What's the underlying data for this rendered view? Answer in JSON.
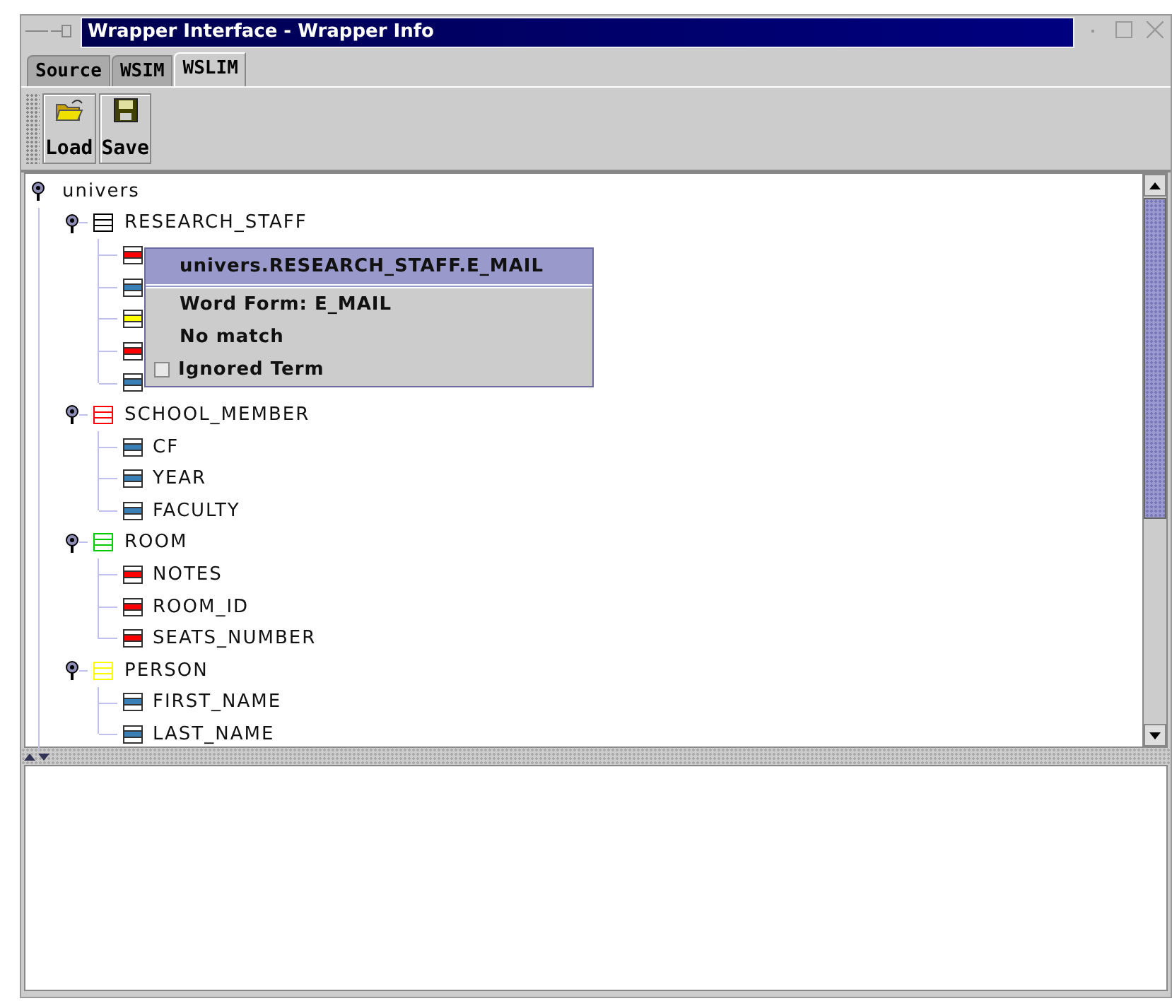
{
  "window": {
    "title": "Wrapper Interface - Wrapper Info"
  },
  "tabs": [
    {
      "label": "Source",
      "selected": false
    },
    {
      "label": "WSIM",
      "selected": false
    },
    {
      "label": "WSLIM",
      "selected": true
    }
  ],
  "toolbar": [
    {
      "label": "Load",
      "kind": "open"
    },
    {
      "label": "Save",
      "kind": "save"
    }
  ],
  "tree": {
    "label": "univers",
    "expanded": true,
    "children": [
      {
        "label": "RESEARCH_STAFF",
        "color": "#000000",
        "expanded": true,
        "children": [
          {
            "color": "#ff0000"
          },
          {
            "color": "#3a7fb5"
          },
          {
            "color": "#ffff00"
          },
          {
            "color": "#ff0000"
          },
          {
            "color": "#3a7fb5"
          }
        ]
      },
      {
        "label": "SCHOOL_MEMBER",
        "color": "#ff0000",
        "expanded": true,
        "children": [
          {
            "label": "CF",
            "color": "#3a7fb5"
          },
          {
            "label": "YEAR",
            "color": "#3a7fb5"
          },
          {
            "label": "FACULTY",
            "color": "#3a7fb5"
          }
        ]
      },
      {
        "label": "ROOM",
        "color": "#00cc00",
        "expanded": true,
        "children": [
          {
            "label": "NOTES",
            "color": "#ff0000"
          },
          {
            "label": "ROOM_ID",
            "color": "#ff0000"
          },
          {
            "label": "SEATS_NUMBER",
            "color": "#ff0000"
          }
        ]
      },
      {
        "label": "PERSON",
        "color": "#ffff00",
        "expanded": true,
        "children": [
          {
            "label": "FIRST_NAME",
            "color": "#3a7fb5"
          },
          {
            "label": "LAST_NAME",
            "color": "#3a7fb5"
          }
        ]
      }
    ]
  },
  "popup_menu": {
    "title": "univers.RESEARCH_STAFF.E_MAIL",
    "items": [
      {
        "label": "Word Form: E_MAIL",
        "kind": "text"
      },
      {
        "label": "No match",
        "kind": "text"
      },
      {
        "label": "Ignored Term",
        "kind": "check",
        "checked": false
      }
    ]
  }
}
